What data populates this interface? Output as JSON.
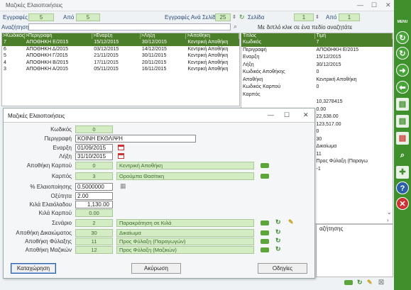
{
  "app": {
    "title": "Μαζικές Ελαιοποιήσεις"
  },
  "toolbar": {
    "records_label": "Εγγραφές",
    "records_value": "5",
    "from_label": "Από",
    "from_value": "5",
    "per_page_label": "Εγγραφές Ανά Σελίδα",
    "per_page_value": "25",
    "page_label": "Σελίδα",
    "page_value": "1",
    "of_label": "Από",
    "of_value": "1",
    "search_label": "Αναζήτηση",
    "search_hint": "Με διπλό κλικ σε ένα πεδίο αναζητάτε"
  },
  "grid": {
    "headers": [
      ">Κωδικός",
      ">Περιγραφή",
      ">Εναρξη",
      ">Λήξη",
      ">Αποθήκη"
    ],
    "rows": [
      [
        "7",
        "ΑΠΟΘΗΚΗ Ε/2015",
        "15/12/2015",
        "30/12/2015",
        "Κεντρική Αποθήκη"
      ],
      [
        "6",
        "ΑΠΟΘΗΚΗ Δ/2015",
        "03/12/2015",
        "14/12/2015",
        "Κεντρική Αποθήκη"
      ],
      [
        "5",
        "ΑΠΟΘΗΚΗ Γ/2015",
        "21/11/2015",
        "30/11/2015",
        "Κεντρική Αποθήκη"
      ],
      [
        "4",
        "ΑΠΟΘΗΚΗ Β/2015",
        "17/11/2015",
        "20/11/2015",
        "Κεντρική Αποθήκη"
      ],
      [
        "3",
        "ΑΠΟΘΗΚΗ Α/2015",
        "05/11/2015",
        "16/11/2015",
        "Κεντρική Αποθήκη"
      ]
    ]
  },
  "detail": {
    "headers": [
      "Τίτλος",
      "Τιμή"
    ],
    "rows": [
      [
        "Κωδικός",
        "7"
      ],
      [
        "Περιγραφή",
        "ΑΠΟΘΗΚΗ Ε/2015"
      ],
      [
        "Εναρξη",
        "15/12/2015"
      ],
      [
        "Λήξη",
        "30/12/2015"
      ],
      [
        "Κωδικός Αποθήκης",
        "0"
      ],
      [
        "Αποθήκη",
        "Κεντρική Αποθήκη"
      ],
      [
        "Κωδικός Καρπού",
        "0"
      ],
      [
        "Καρπός",
        ""
      ],
      [
        "",
        "10,3278415"
      ],
      [
        "",
        "0.00"
      ],
      [
        "",
        "22,638.00"
      ],
      [
        "",
        "123,517.00"
      ],
      [
        "",
        "0"
      ],
      [
        "",
        "30"
      ],
      [
        "",
        "Δικαίωμα"
      ],
      [
        "",
        "11"
      ],
      [
        "",
        "Προς Φύλαξη (Παραγω"
      ],
      [
        "",
        "-1"
      ]
    ],
    "footer_label": "αζήτησης"
  },
  "dialog": {
    "title": "Μαζικές Ελαιοποιήσεις",
    "code_label": "Κωδικός",
    "code_value": "0",
    "desc_label": "Περιγραφή",
    "desc_value": "ΚΟΙΝΗ ΕΚΘΛΙΨΗ",
    "start_label": "Εναρξη",
    "start_value": "01/09/2015",
    "end_label": "Λήξη",
    "end_value": "31/10/2015",
    "warehouse_code_label": "Αποθήκη Καρπού",
    "warehouse_code_value": "0",
    "warehouse_name": "Κεντρική Αποθήκη",
    "fruit_label": "Καρπός",
    "fruit_code": "3",
    "fruit_name": "Ορούμπα Θασίτικη",
    "pct_label": "% Ελαιοποίησης",
    "pct_value": "0.5000000",
    "acidity_label": "Οξύτητα",
    "acidity_value": "2.00",
    "oil_kg_label": "Κιλά Ελαιόλαδου",
    "oil_kg_value": "1,130.00",
    "fruit_kg_label": "Κιλά Καρπού",
    "fruit_kg_value": "0.00",
    "scenario_label": "Σενάριο",
    "scenario_code": "2",
    "scenario_name": "Παρακράτηση σε Κιλά",
    "rights_wh_label": "Αποθήκη Δικαιώματος",
    "rights_wh_code": "30",
    "rights_wh_name": "Δικαίωμα",
    "storage_wh_label": "Αποθήκη Φύλαξης",
    "storage_wh_code": "11",
    "storage_wh_name": "Προς Φύλαξη (Παραγωγών)",
    "bulk_wh_label": "Αποθήκη Μαζικών",
    "bulk_wh_code": "12",
    "bulk_wh_name": "Προς Φύλαξη (Μαζικών)",
    "save_label": "Καταχώρηση",
    "cancel_label": "Ακύρωση",
    "help_label": "Οδηγίες"
  },
  "sidebar": {
    "menu_label": "MENU"
  }
}
